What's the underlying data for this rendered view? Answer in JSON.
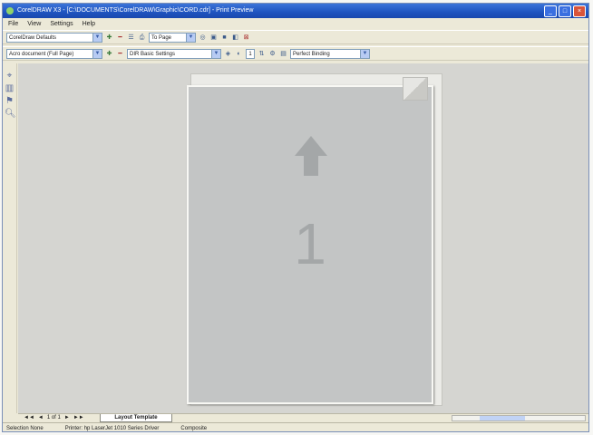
{
  "window": {
    "title": "CorelDRAW X3 - [C:\\DOCUMENTS\\CorelDRAW\\Graphic\\CORD.cdr] - Print Preview",
    "controls": [
      "_",
      "□",
      "×"
    ]
  },
  "menu": {
    "items": [
      "File",
      "View",
      "Settings",
      "Help"
    ]
  },
  "toolbar1": {
    "style": "CorelDraw Defaults",
    "zoom": "To Page"
  },
  "toolbar2": {
    "pages": "Acro document (Full Page)",
    "separations": "DIR Basic Settings",
    "binding": "Perfect Binding"
  },
  "page": {
    "number": "1"
  },
  "tabs": {
    "nav": [
      "◄◄",
      "◄",
      "1 of 1",
      "►",
      "►►"
    ],
    "layout_tab": "Layout Template"
  },
  "status": {
    "selection": "Selection None",
    "printer": "Printer: hp LaserJet 1010 Series Driver",
    "mode": "Composite"
  },
  "colors": {
    "titlebar": "#1f54c0",
    "workspace": "#d5d5d1",
    "page": "#c3c5c5"
  }
}
